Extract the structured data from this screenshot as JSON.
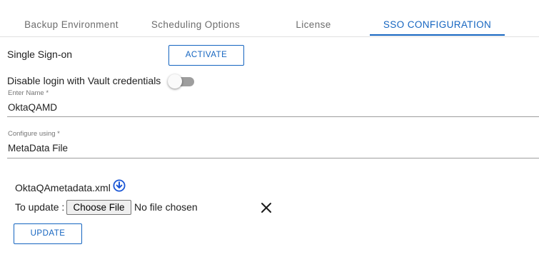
{
  "tabs": [
    {
      "label": "Backup Environment"
    },
    {
      "label": "Scheduling Options"
    },
    {
      "label": "License"
    },
    {
      "label": "SSO CONFIGURATION"
    }
  ],
  "active_tab": 3,
  "colors": {
    "accent": "#1565c0",
    "toggle_track": "#9e9e9e"
  },
  "sso": {
    "label": "Single Sign-on",
    "activate_label": "ACTIVATE",
    "disable_login_label": "Disable login with Vault credentials",
    "disable_login_enabled": false
  },
  "fields": {
    "name": {
      "label": "Enter Name *",
      "value": "OktaQAMD"
    },
    "configure": {
      "label": "Configure using *",
      "value": "MetaData File"
    }
  },
  "file": {
    "name": "OktaQAmetadata.xml",
    "download_icon": "download-icon",
    "update_label": "To update :",
    "choose_label": "Choose File",
    "chosen_text": "No file chosen",
    "clear_icon": "close-icon"
  },
  "update_button": "UPDATE"
}
